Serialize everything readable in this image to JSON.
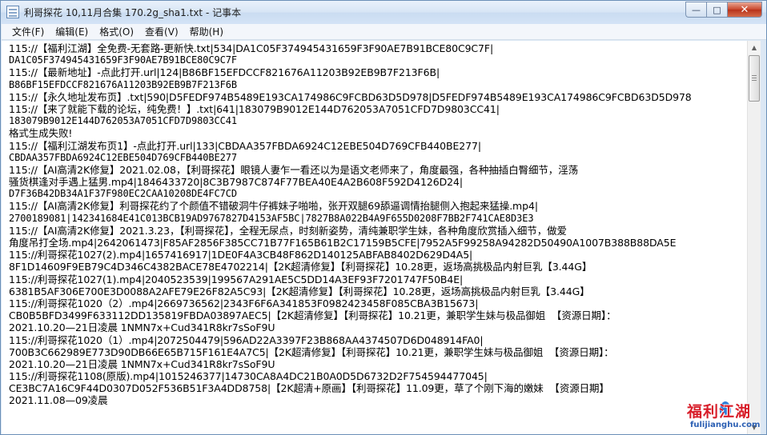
{
  "window": {
    "title": "利哥探花 10,11月合集 170.2g_sha1.txt - 记事本",
    "minimize_glyph": "—",
    "maximize_glyph": "□",
    "close_glyph": "✕"
  },
  "menu": [
    {
      "label": "文件(F)"
    },
    {
      "label": "编辑(E)"
    },
    {
      "label": "格式(O)"
    },
    {
      "label": "查看(V)"
    },
    {
      "label": "帮助(H)"
    }
  ],
  "lines": [
    "115://【福利江湖】全免费-无套路-更新快.txt|534|DA1C05F374945431659F3F90AE7B91BCE80C9C7F|",
    "DA1C05F374945431659F3F90AE7B91BCE80C9C7F",
    "115://【最新地址】-点此打开.url|124|B86BF15EFDCCF821676A11203B92EB9B7F213F6B|",
    "B86BF15EFDCCF821676A11203B92EB9B7F213F6B",
    "115://【永久地址发布页】.txt|590|D5FEDF974B5489E193CA174986C9FCBD63D5D978|D5FEDF974B5489E193CA174986C9FCBD63D5D978",
    "115://【来了就能下载的论坛，纯免费！】.txt|641|183079B9012E144D762053A7051CFD7D9803CC41|",
    "183079B9012E144D762053A7051CFD7D9803CC41",
    "格式生成失败!",
    "115://【福利江湖发布页1】-点此打开.url|133|CBDAA357FBDA6924C12EBE504D769CFB440BE277|",
    "CBDAA357FBDA6924C12EBE504D769CFB440BE277",
    "115://【AI高清2K修复】2021.02.08，【利哥探花】眼镜人妻乍一看还以为是语文老师来了，角度最强，各种抽插白臀细节，淫荡",
    "骚货棋逢对手遇上猛男.mp4|1846433720|8C3B7987C874F77BEA40E4A2B608F592D4126D24|",
    "D7F36B42DB34A1F37F980EC2CAA10208DE4FC7CD",
    "115://【AI高清2K修复】利哥探花约了个颜值不错破洞牛仔裤妹子啪啪，张开双腿69舔逼调情抬腿侧入抱起来猛操.mp4|",
    "2700189081|142341684E41C013BCB19AD9767827D4153AF5BC|7827B8A022B4A9F655D0208F7BB2F741CAE8D3E3",
    "115://【AI高清2K修复】2021.3.23，【利哥探花】，全程无尿点，时刻新姿势，清纯兼职学生妹，各种角度欣赏插入细节，做爱",
    "角度吊打全场.mp4|2642061473|F85AF2856F385CC71B77F165B61B2C17159B5CFE|7952A5F99258A94282D50490A1007B388B88DA5E",
    "115://利哥探花1027(2).mp4|1657416917|1DE0F4A3CB48F862D140125ABFAB8402D629D4A5|",
    "8F1D14609F9EB79C4D346C4382BACE78E4702214|【2K超清修复】【利哥探花】10.28更，返场高挑极品内射巨乳【3.44G】",
    "115://利哥探花1027(1).mp4|2040523539|199567A291AE5C5DD14A3EF93F7201747F50B4E|",
    "6381B5AF306E700E3D0088A2AFE79E26F82A5C93|【2K超清修复】【利哥探花】10.28更，返场高挑极品内射巨乳【3.44G】",
    "115://利哥探花1020（2）.mp4|2669736562|2343F6F6A341853F0982423458F085CBA3B15673|",
    "CB0B5BFD3499F633112DD135819FBDA03897AEC5|【2K超清修复】【利哥探花】10.21更，兼职学生妹与极品御姐  【资源日期】：",
    "2021.10.20—21日凌晨 1NMN7x+Cud341R8kr7sSoF9U",
    "115://利哥探花1020（1）.mp4|2072504479|596AD22A3397F23B868AA4374507D6D048914FA0|",
    "700B3C662989E773D90DB66E65B715F161E4A7C5|【2K超清修复】【利哥探花】10.21更，兼职学生妹与极品御姐  【资源日期】：",
    "2021.10.20—21日凌晨 1NMN7x+Cud341R8kr7sSoF9U",
    "115://利哥探花1108(原版).mp4|1015246377|14730CA8A4DC21B0A0D5D6732D2F754594477045|",
    "CE3BC7A16C9F44D0307D052F536B51F3A4DD8758|【2K超清+原画】【利哥探花】11.09更，草了个刚下海的嫩妹  【资源日期】",
    "2021.11.08—09凌晨"
  ],
  "watermark": {
    "title": "福利江湖",
    "url": "fulijianghu.com"
  },
  "scrollbar": {
    "up_glyph": "▲",
    "down_glyph": "▼"
  }
}
